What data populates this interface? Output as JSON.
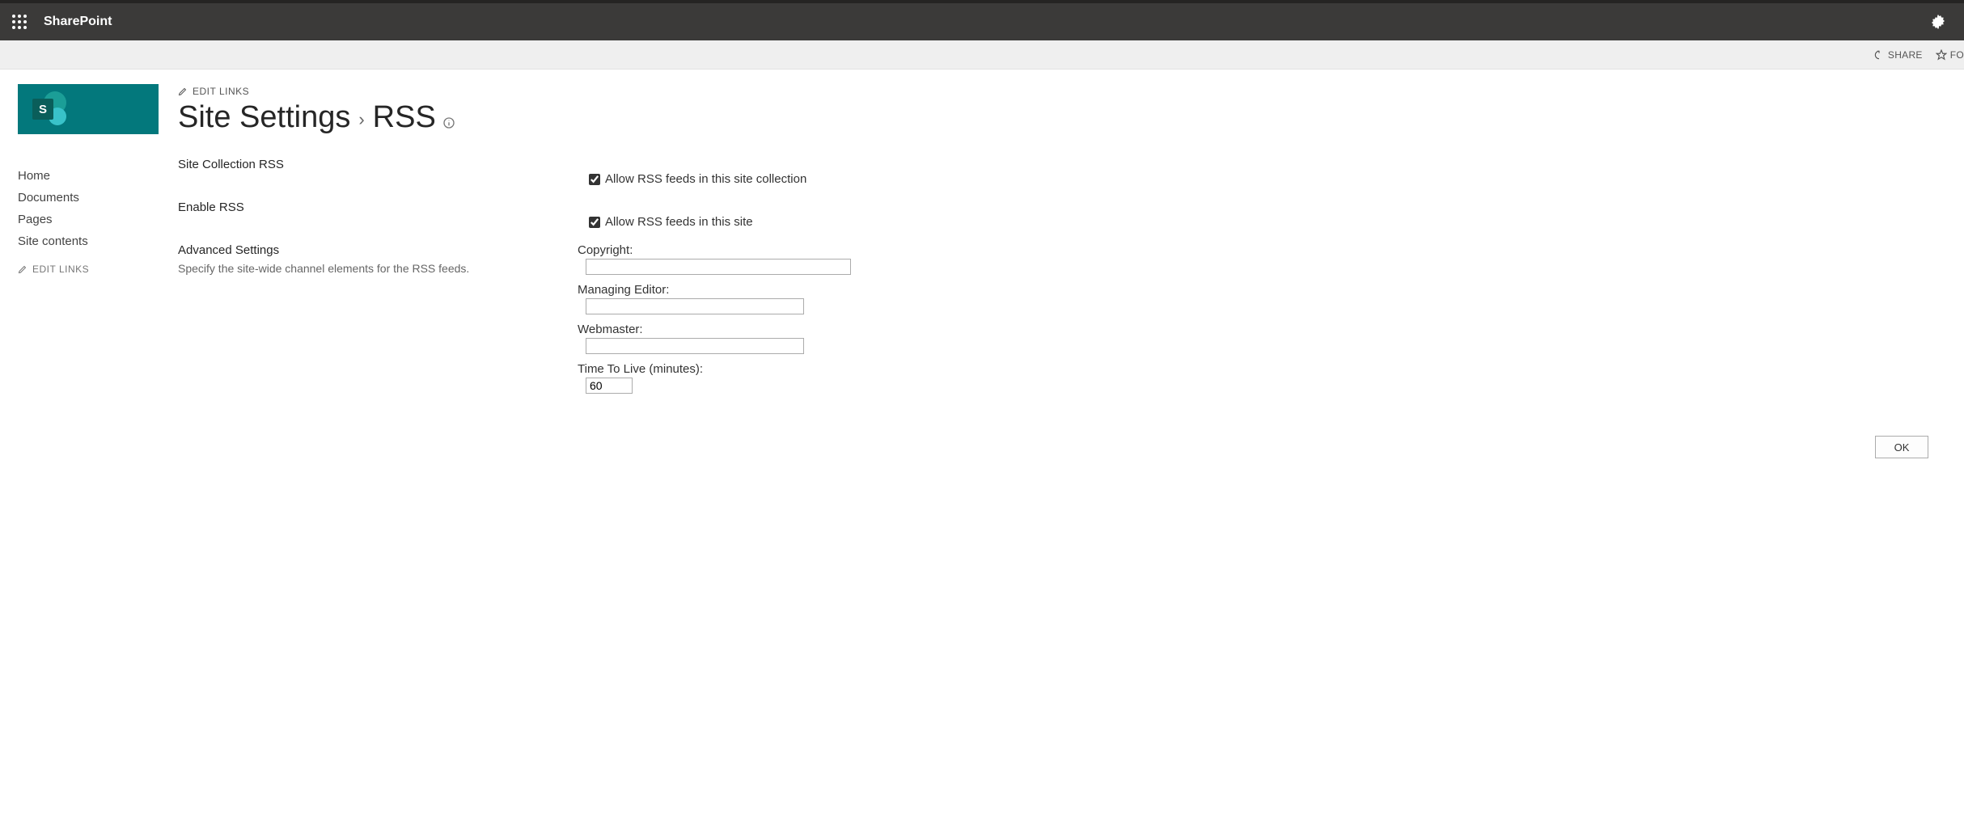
{
  "suite": {
    "app_name": "SharePoint"
  },
  "ribbon": {
    "share": "SHARE",
    "follow": "FO"
  },
  "left_nav": {
    "items": [
      "Home",
      "Documents",
      "Pages",
      "Site contents"
    ],
    "edit_links": "EDIT LINKS"
  },
  "breadcrumb": {
    "edit_links": "EDIT LINKS",
    "parent": "Site Settings",
    "current": "RSS"
  },
  "sections": {
    "site_collection_rss": {
      "title": "Site Collection RSS",
      "checkbox_label": "Allow RSS feeds in this site collection",
      "checked": true
    },
    "enable_rss": {
      "title": "Enable RSS",
      "checkbox_label": "Allow RSS feeds in this site",
      "checked": true
    },
    "advanced": {
      "title": "Advanced Settings",
      "help": "Specify the site-wide channel elements for the RSS feeds.",
      "fields": {
        "copyright_label": "Copyright:",
        "copyright_value": "",
        "managing_editor_label": "Managing Editor:",
        "managing_editor_value": "",
        "webmaster_label": "Webmaster:",
        "webmaster_value": "",
        "ttl_label": "Time To Live (minutes):",
        "ttl_value": "60"
      }
    }
  },
  "buttons": {
    "ok": "OK"
  },
  "site_logo_letter": "S"
}
